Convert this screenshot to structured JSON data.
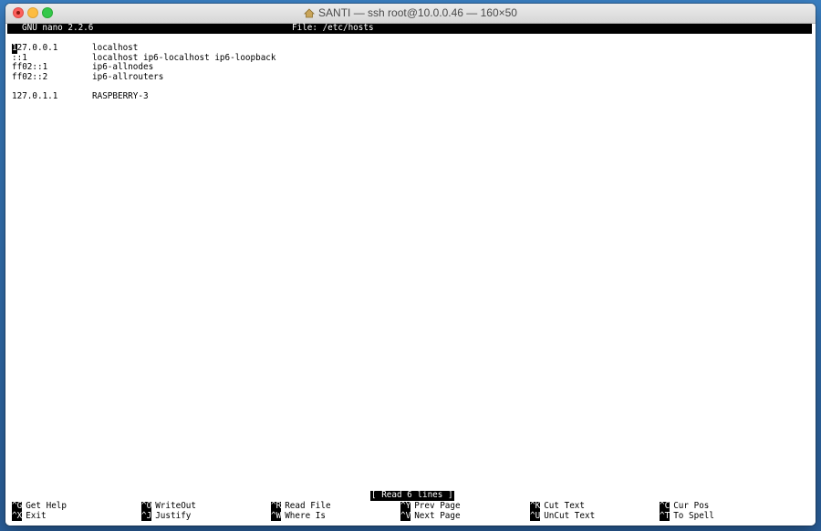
{
  "window": {
    "title": "SANTI — ssh root@10.0.0.46 — 160×50"
  },
  "nano": {
    "version": "GNU nano 2.2.6",
    "file_label": "File: /etc/hosts",
    "lines": [
      {
        "ip": "127.0.0.1",
        "name": "localhost"
      },
      {
        "ip": "::1",
        "name": "localhost ip6-localhost ip6-loopback"
      },
      {
        "ip": "ff02::1",
        "name": "ip6-allnodes"
      },
      {
        "ip": "ff02::2",
        "name": "ip6-allrouters"
      },
      {
        "ip": "",
        "name": ""
      },
      {
        "ip": "127.0.1.1",
        "name": "RASPBERRY-3"
      }
    ],
    "status": "[ Read 6 lines ]",
    "shortcuts_row1": [
      {
        "key": "^G",
        "label": "Get Help"
      },
      {
        "key": "^O",
        "label": "WriteOut"
      },
      {
        "key": "^R",
        "label": "Read File"
      },
      {
        "key": "^Y",
        "label": "Prev Page"
      },
      {
        "key": "^K",
        "label": "Cut Text"
      },
      {
        "key": "^C",
        "label": "Cur Pos"
      }
    ],
    "shortcuts_row2": [
      {
        "key": "^X",
        "label": "Exit"
      },
      {
        "key": "^J",
        "label": "Justify"
      },
      {
        "key": "^W",
        "label": "Where Is"
      },
      {
        "key": "^V",
        "label": "Next Page"
      },
      {
        "key": "^U",
        "label": "UnCut Text"
      },
      {
        "key": "^T",
        "label": "To Spell"
      }
    ]
  },
  "icons": {
    "title_icon": "home-icon"
  }
}
